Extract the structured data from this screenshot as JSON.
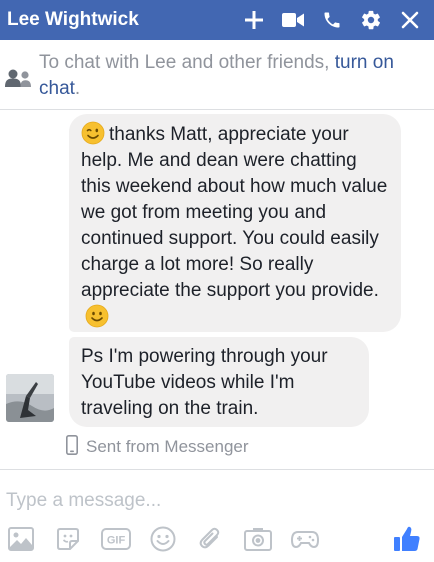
{
  "header": {
    "title": "Lee Wightwick",
    "bg_color": "#4267b2",
    "icons": [
      "plus-icon",
      "video-camera-icon",
      "phone-icon",
      "gear-icon",
      "close-icon"
    ]
  },
  "notice": {
    "text": "To chat with Lee and other friends, ",
    "link": "turn on chat",
    "suffix": "."
  },
  "messages": [
    {
      "text": "thanks Matt, appreciate your help. Me and dean were chatting this weekend about how much value we got from meeting you and continued support. You could easily charge a lot more! So really appreciate the support you provide.",
      "emojis": [
        "wink-emoji",
        "smile-emoji"
      ]
    },
    {
      "text": "Ps I'm powering through your YouTube videos while I'm traveling on the train."
    }
  ],
  "sent_from": "Sent from Messenger",
  "composer": {
    "placeholder": "Type a message...",
    "tools": [
      "photo-icon",
      "sticker-icon",
      "gif-icon",
      "emoji-icon",
      "attachment-icon",
      "camera-icon",
      "game-controller-icon",
      "like-icon"
    ],
    "gif_label": "GIF",
    "like_color": "#4080ff"
  }
}
